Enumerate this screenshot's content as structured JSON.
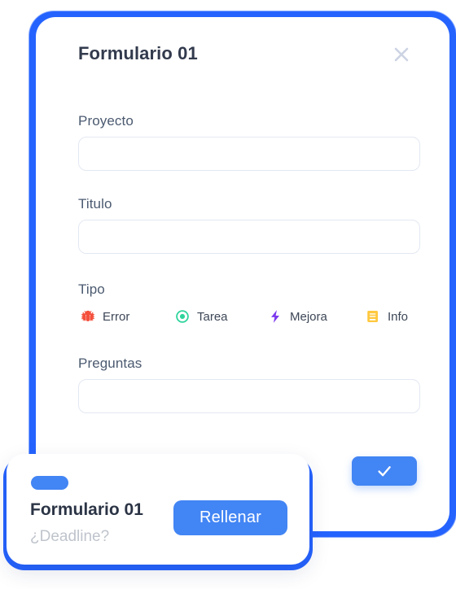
{
  "dialog": {
    "title": "Formulario 01",
    "close_icon": "close-icon",
    "fields": [
      {
        "label": "Proyecto",
        "value": "",
        "placeholder": ""
      },
      {
        "label": "Titulo",
        "value": "",
        "placeholder": ""
      },
      {
        "label": "Preguntas",
        "value": "",
        "placeholder": ""
      }
    ],
    "tipo": {
      "label": "Tipo",
      "options": [
        {
          "label": "Error",
          "icon": "bug-icon",
          "color": "#f4503c"
        },
        {
          "label": "Tarea",
          "icon": "target-icon",
          "color": "#2ed49b"
        },
        {
          "label": "Mejora",
          "icon": "lightning-icon",
          "color": "#7c3aed"
        },
        {
          "label": "Info",
          "icon": "book-icon",
          "color": "#ffc83d"
        }
      ]
    },
    "submit": {
      "icon": "check-icon",
      "label": "",
      "color": "#4285f4"
    }
  },
  "task_card": {
    "badge_label": "",
    "title": "Formulario 01",
    "subtitle": "¿Deadline?",
    "action_label": "Rellenar",
    "accent_color": "#4285f4"
  },
  "theme": {
    "frame_blue": "#2563ff",
    "label_slate": "#4b5a70",
    "title_navy": "#323a4d",
    "muted_gray": "#bfc4cc",
    "border_light": "#e3e8f2"
  }
}
